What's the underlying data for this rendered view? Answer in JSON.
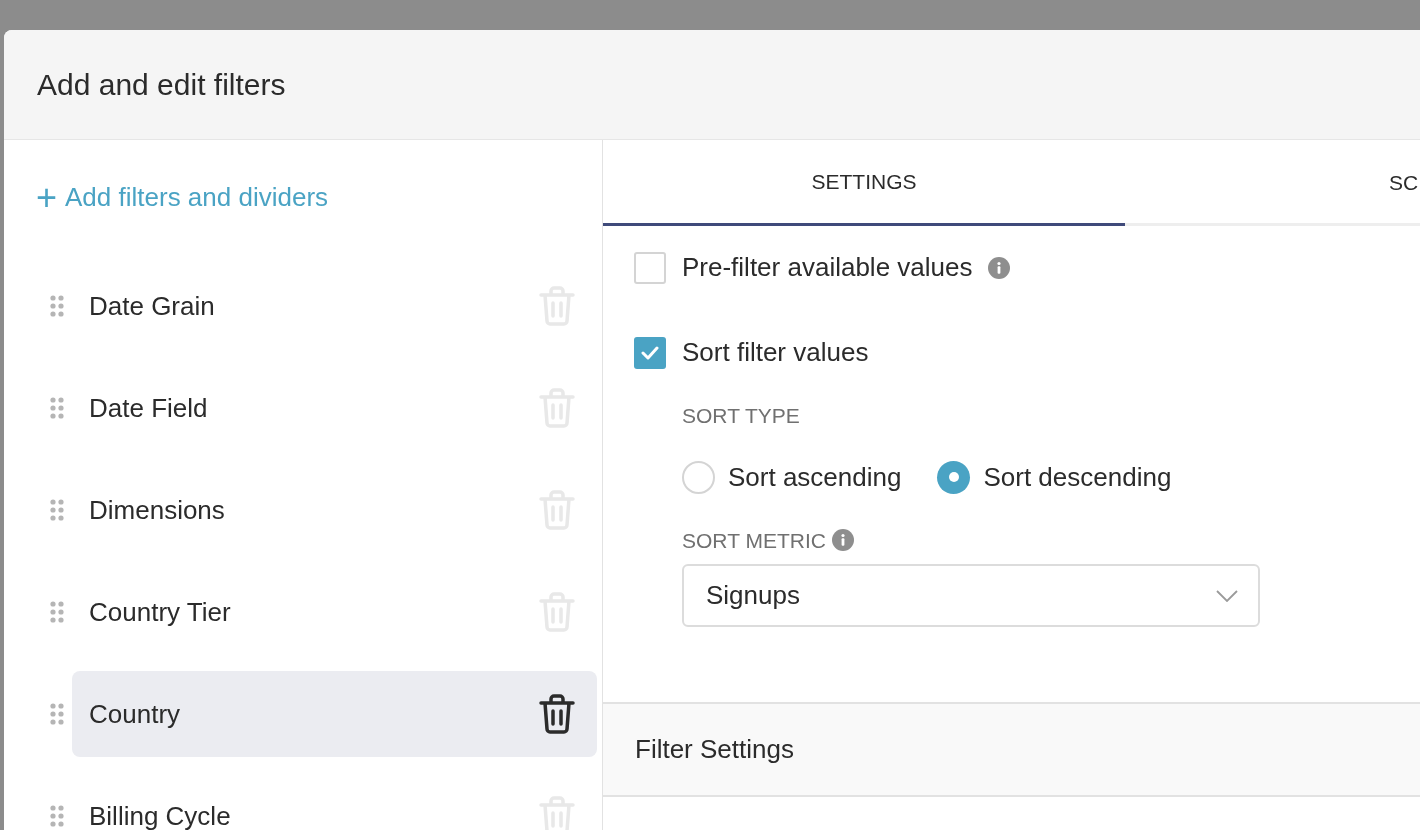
{
  "dialog": {
    "title": "Add and edit filters"
  },
  "add_link": {
    "icon": "+",
    "label": "Add filters and dividers"
  },
  "filters": [
    {
      "label": "Date Grain",
      "selected": false
    },
    {
      "label": "Date Field",
      "selected": false
    },
    {
      "label": "Dimensions",
      "selected": false
    },
    {
      "label": "Country Tier",
      "selected": false
    },
    {
      "label": "Country",
      "selected": true
    },
    {
      "label": "Billing Cycle",
      "selected": false
    }
  ],
  "tabs": [
    {
      "label": "SETTINGS",
      "selected": true
    },
    {
      "label": "SC",
      "selected": false
    }
  ],
  "options": [
    {
      "label": "Pre-filter available values",
      "checked": false,
      "info": true
    },
    {
      "label": "Sort filter values",
      "checked": true,
      "info": false
    }
  ],
  "sort_type": {
    "label": "SORT TYPE",
    "choices": [
      {
        "label": "Sort ascending",
        "selected": false
      },
      {
        "label": "Sort descending",
        "selected": true
      }
    ]
  },
  "sort_metric": {
    "label": "SORT METRIC",
    "value": "Signups"
  },
  "section": {
    "title": "Filter Settings"
  }
}
